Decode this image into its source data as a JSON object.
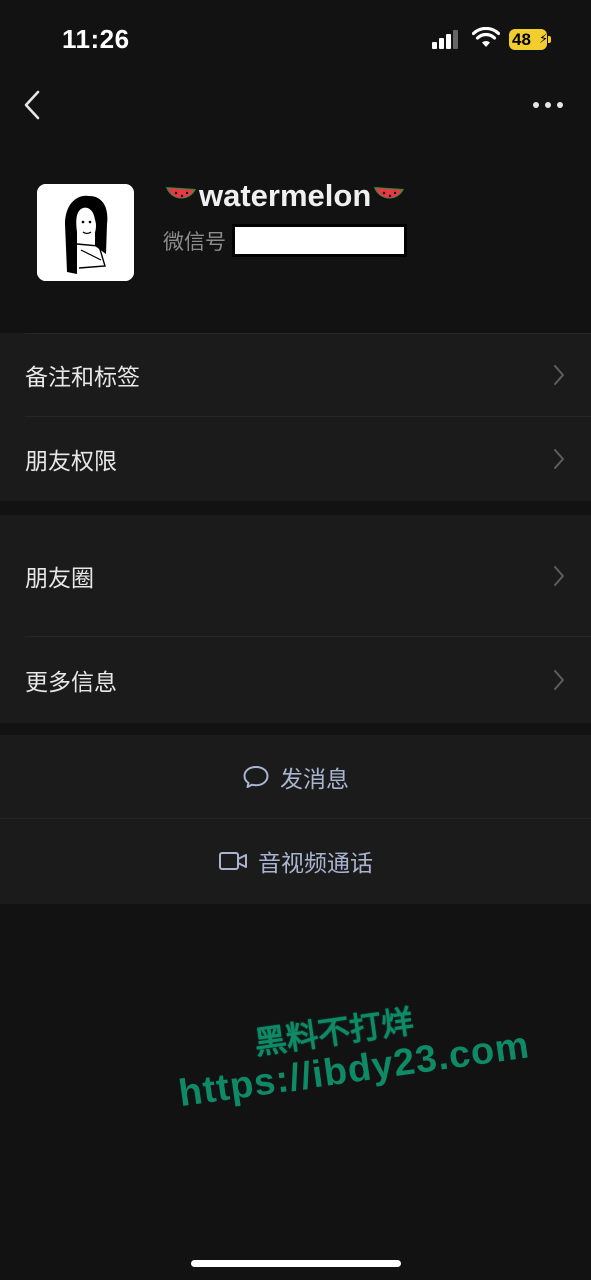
{
  "status_bar": {
    "time": "11:26",
    "battery": "48"
  },
  "profile": {
    "name": "watermelon",
    "wechat_id_label": "微信号"
  },
  "menu_group_1": [
    {
      "label": "备注和标签"
    },
    {
      "label": "朋友权限"
    }
  ],
  "menu_group_2": [
    {
      "label": "朋友圈"
    },
    {
      "label": "更多信息"
    }
  ],
  "actions": {
    "send_message": "发消息",
    "video_call": "音视频通话"
  },
  "watermark": {
    "line1": "黑料不打烊",
    "line2": "https://ibdy23.com"
  },
  "colors": {
    "background": "#121212",
    "row_background": "#1b1b1b",
    "action_text": "#a9b4cf",
    "battery": "#f2cd2e",
    "watermark": "#0f8a66"
  }
}
